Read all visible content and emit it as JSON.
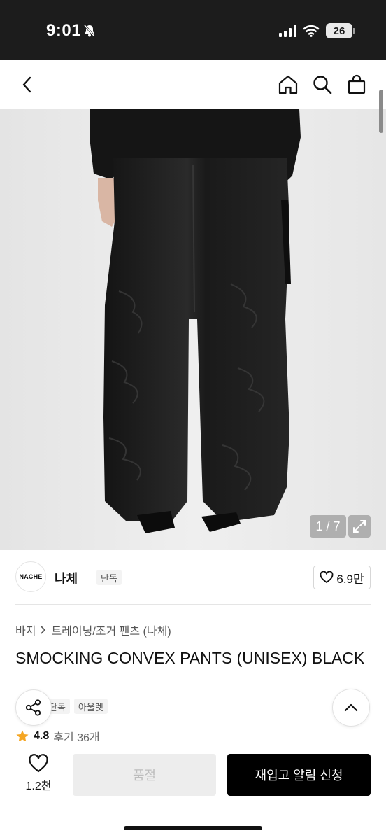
{
  "status_bar": {
    "time": "9:01",
    "battery": "26"
  },
  "nav": {
    "back_icon": "chevron-left-icon",
    "home_icon": "home-icon",
    "search_icon": "search-icon",
    "cart_icon": "shopping-bag-icon"
  },
  "gallery": {
    "counter": "1 / 7",
    "expand_icon": "expand-icon"
  },
  "brand": {
    "logo_text": "NACHE",
    "name": "나체",
    "badge": "단독",
    "likes": "6.9만"
  },
  "breadcrumb": {
    "category": "바지",
    "subcategory": "트레이닝/조거 팬츠 (나체)"
  },
  "product": {
    "title": "SMOCKING CONVEX PANTS (UNISEX) BLACK",
    "tags": [
      "단독",
      "아울렛"
    ],
    "rating": "4.8",
    "reviews": "후기 36개"
  },
  "actions": {
    "wish_count": "1.2천",
    "soldout_label": "품절",
    "restock_label": "재입고 알림 신청"
  },
  "colors": {
    "accent_star": "#f5a623",
    "primary_button": "#000000",
    "disabled_button": "#ededed"
  }
}
